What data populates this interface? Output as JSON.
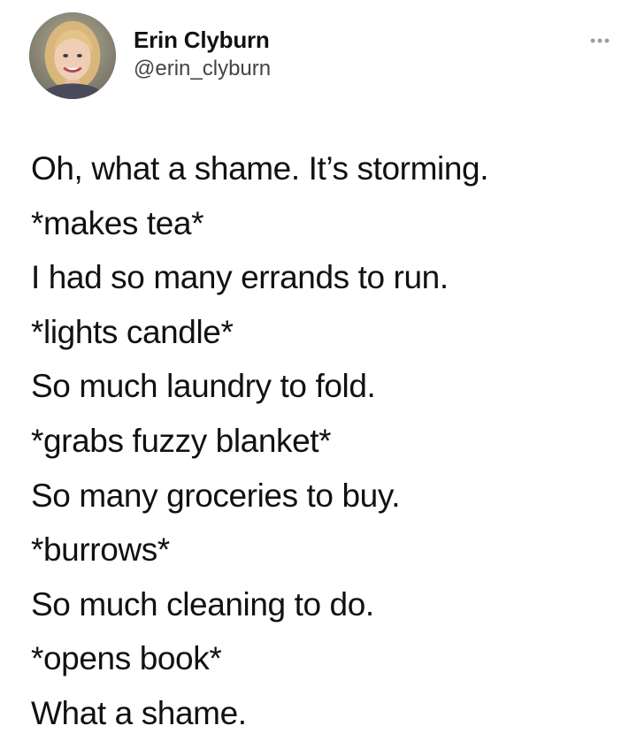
{
  "author": {
    "display_name": "Erin Clyburn",
    "handle": "@erin_clyburn",
    "avatar_icon": "profile-photo-icon"
  },
  "menu": {
    "icon": "more-options-icon"
  },
  "tweet": {
    "lines": [
      "Oh, what a shame. It’s storming.",
      "*makes tea*",
      "I had so many errands to run.",
      "*lights candle*",
      "So much laundry to fold.",
      "*grabs fuzzy blanket*",
      "So many groceries to buy.",
      "*burrows*",
      "So much cleaning to do.",
      "*opens book*",
      "What a shame."
    ]
  },
  "colors": {
    "text": "#111111",
    "handle": "#444444",
    "background": "#ffffff",
    "menu_dots": "#9a9a9a"
  }
}
